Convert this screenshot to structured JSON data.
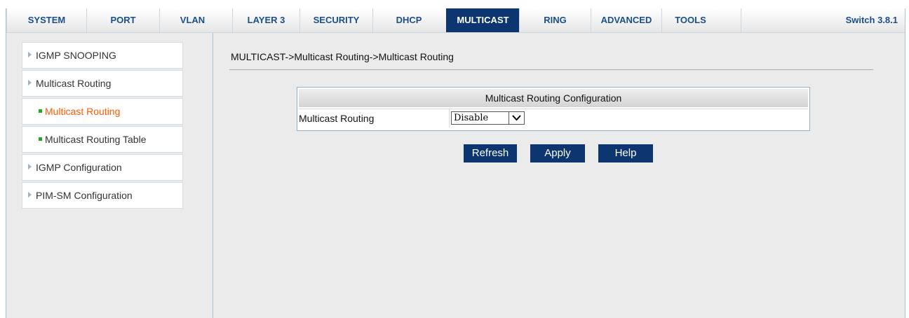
{
  "nav": {
    "tabs": [
      {
        "label": "SYSTEM"
      },
      {
        "label": "PORT"
      },
      {
        "label": "VLAN"
      },
      {
        "label": "LAYER 3"
      },
      {
        "label": "SECURITY"
      },
      {
        "label": "DHCP"
      },
      {
        "label": "MULTICAST"
      },
      {
        "label": "RING"
      },
      {
        "label": "ADVANCED"
      },
      {
        "label": "TOOLS"
      }
    ],
    "active_tab": "MULTICAST",
    "version": "Switch 3.8.1"
  },
  "sidebar": {
    "items": [
      {
        "label": "IGMP SNOOPING"
      },
      {
        "label": "Multicast Routing"
      },
      {
        "label": "Multicast Routing"
      },
      {
        "label": "Multicast Routing Table"
      },
      {
        "label": "IGMP Configuration"
      },
      {
        "label": "PIM-SM Configuration"
      }
    ],
    "current_item": "Multicast Routing"
  },
  "main": {
    "breadcrumb": "MULTICAST->Multicast Routing->Multicast Routing",
    "table": {
      "header": "Multicast Routing Configuration",
      "row_label": "Multicast Routing",
      "row_value": "Disable"
    },
    "buttons": {
      "refresh": "Refresh",
      "apply": "Apply",
      "help": "Help"
    }
  },
  "colors": {
    "accent": "#0d3670",
    "nav_text": "#1a4f8c",
    "current_link": "#ff5a00",
    "sub_bullet": "#22a628",
    "background": "#ebebeb"
  },
  "icons": {
    "nav_arrow": "triangle-right-icon",
    "sub_bullet": "green-square-icon",
    "dropdown": "chevron-down-icon"
  }
}
